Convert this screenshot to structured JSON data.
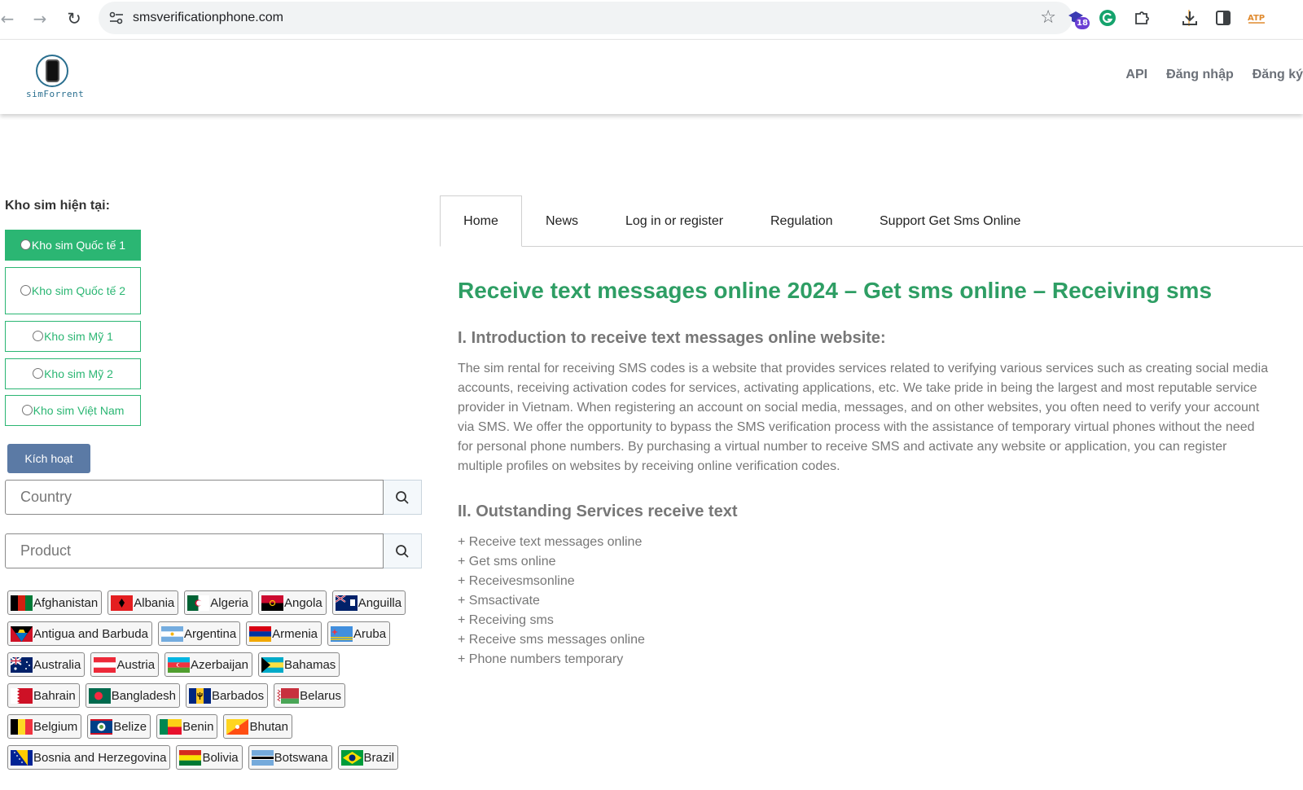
{
  "browser": {
    "url": "smsverificationphone.com",
    "extension_badge": "18"
  },
  "header": {
    "logo_text": "simForrent",
    "nav": [
      "API",
      "Đăng nhập",
      "Đăng ký"
    ]
  },
  "sidebar": {
    "title": "Kho sim hiện tại:",
    "stocks": [
      "Kho sim Quốc tế 1",
      "Kho sim Quốc tế 2",
      "Kho sim Mỹ 1",
      "Kho sim Mỹ 2",
      "Kho sim Việt Nam"
    ],
    "activate_label": "Kích hoạt",
    "country_placeholder": "Country",
    "product_placeholder": "Product",
    "countries": [
      [
        "Afghanistan",
        "Albania",
        "Algeria",
        "Angola",
        "Anguilla"
      ],
      [
        "Antigua and Barbuda",
        "Argentina",
        "Armenia",
        "Aruba"
      ],
      [
        "Australia",
        "Austria",
        "Azerbaijan",
        "Bahamas"
      ],
      [
        "Bahrain",
        "Bangladesh",
        "Barbados",
        "Belarus"
      ],
      [
        "Belgium",
        "Belize",
        "Benin",
        "Bhutan"
      ],
      [
        "Bosnia and Herzegovina",
        "Bolivia",
        "Botswana",
        "Brazil"
      ]
    ]
  },
  "tabs": [
    "Home",
    "News",
    "Log in or register",
    "Regulation",
    "Support Get Sms Online"
  ],
  "content": {
    "title": "Receive text messages online 2024 – Get sms online – Receiving sms",
    "section1_heading": "I. Introduction to receive text messages online website:",
    "section1_text": "The sim rental for receiving SMS codes is a website that provides services related to verifying various services such as creating social media accounts, receiving activation codes for services, activating applications, etc. We take pride in being the largest and most reputable service provider in Vietnam. When registering an account on social media, messages, and on other websites, you often need to verify your account via SMS. We offer the opportunity to bypass the SMS verification process with the assistance of temporary virtual phones without the need for personal phone numbers. By purchasing a virtual number to receive SMS and activate any website or application, you can register multiple profiles on websites by receiving online verification codes.",
    "section2_heading": "II. Outstanding Services receive text",
    "services": [
      "+ Receive text messages online",
      "+ Get sms online",
      "+ Receivesmsonline",
      "+ Smsactivate",
      "+ Receiving sms",
      "+ Receive sms messages online",
      "+ Phone numbers temporary"
    ]
  }
}
